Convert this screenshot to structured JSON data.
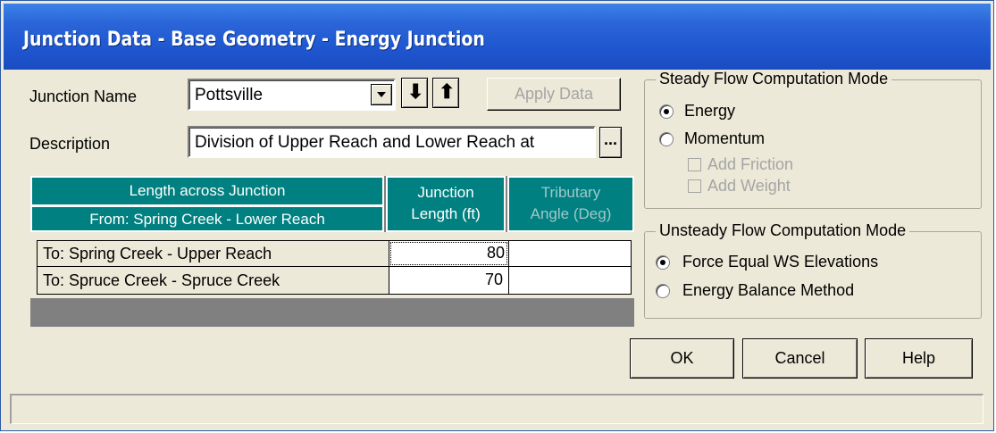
{
  "window": {
    "title": "Junction Data - Base Geometry - Energy Junction"
  },
  "form": {
    "junction_name_label": "Junction Name",
    "junction_name_value": "Pottsville",
    "down_arrow": "⬇",
    "up_arrow": "⬆",
    "apply_label": "Apply Data",
    "description_label": "Description",
    "description_value": "Division of Upper Reach and Lower Reach at",
    "ellipsis_label": "..."
  },
  "grid": {
    "header_length_across": "Length across Junction",
    "header_from": "From: Spring Creek - Lower Reach",
    "header_junction_length": [
      "Junction",
      "Length (ft)"
    ],
    "header_tributary_angle": [
      "Tributary",
      "Angle (Deg)"
    ],
    "rows": [
      {
        "to": "To: Spring Creek - Upper Reach",
        "length": "80",
        "angle": ""
      },
      {
        "to": "To: Spruce Creek - Spruce Creek",
        "length": "70",
        "angle": ""
      }
    ]
  },
  "steady": {
    "title": "Steady Flow Computation Mode",
    "energy_label": "Energy",
    "momentum_label": "Momentum",
    "add_friction_label": "Add Friction",
    "add_weight_label": "Add Weight",
    "selected": "Energy"
  },
  "unsteady": {
    "title": "Unsteady Flow Computation Mode",
    "force_equal_label": "Force Equal WS Elevations",
    "energy_balance_label": "Energy Balance Method",
    "selected": "Force Equal WS Elevations"
  },
  "buttons": {
    "ok": "OK",
    "cancel": "Cancel",
    "help": "Help"
  },
  "status": {
    "text": ""
  }
}
